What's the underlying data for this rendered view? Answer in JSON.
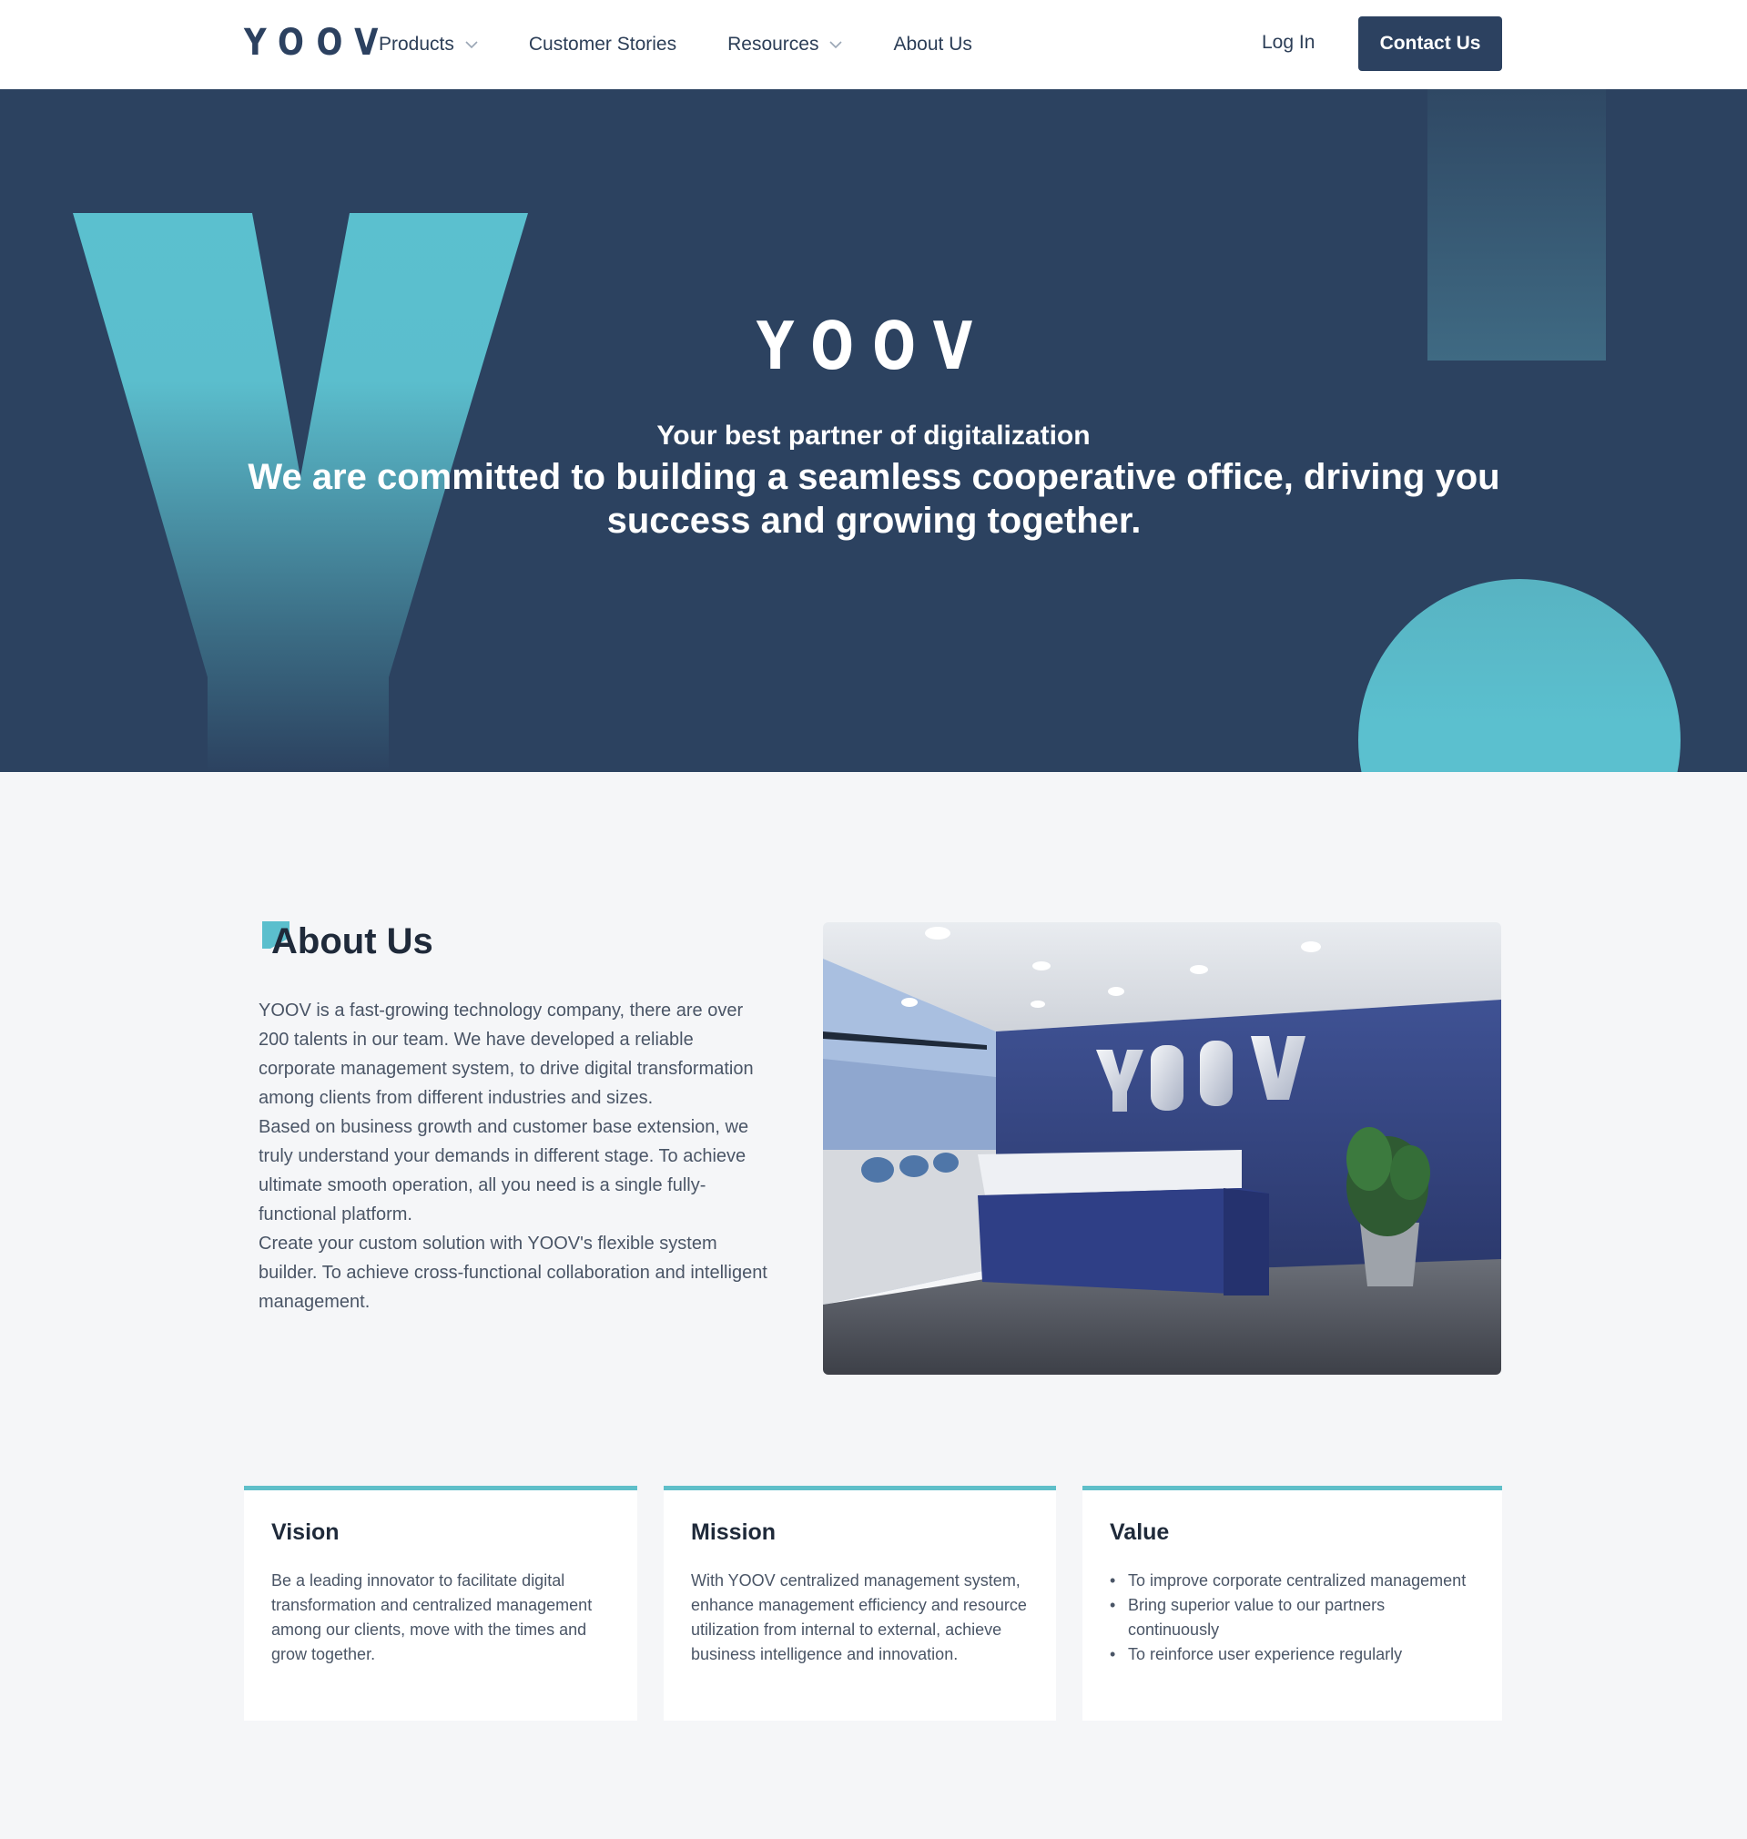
{
  "header": {
    "logo": "YOOV",
    "nav": [
      {
        "label": "Products",
        "has_dropdown": true
      },
      {
        "label": "Customer Stories",
        "has_dropdown": false
      },
      {
        "label": "Resources",
        "has_dropdown": true
      },
      {
        "label": "About Us",
        "has_dropdown": false
      }
    ],
    "login_label": "Log In",
    "contact_label": "Contact Us"
  },
  "hero": {
    "logo": "YOOV",
    "subtitle": "Your best partner of digitalization",
    "headline": "We are committed to building a seamless cooperative office, driving you success and growing together."
  },
  "about": {
    "title": "About Us",
    "paragraphs": [
      "YOOV is a fast-growing technology company, there are over 200 talents in our team. We have developed a reliable corporate management system, to drive digital transformation among clients from different industries and sizes.",
      "Based on business growth and customer base extension, we truly understand your demands in different stage. To achieve ultimate smooth operation, all you need is a single fully-functional platform.",
      "Create your custom solution with YOOV's flexible system builder. To achieve cross-functional collaboration and intelligent management."
    ],
    "photo_sign_text": "YOOV"
  },
  "cards": {
    "vision": {
      "title": "Vision",
      "body": "Be a leading innovator to facilitate digital transformation and centralized management among our clients, move with the times and grow together."
    },
    "mission": {
      "title": "Mission",
      "body": "With YOOV centralized management system, enhance management efficiency and resource utilization from internal to external, achieve business intelligence and innovation."
    },
    "value": {
      "title": "Value",
      "items": [
        "To improve corporate centralized management",
        "Bring superior value to our partners continuously",
        "To reinforce user experience regularly"
      ]
    }
  },
  "colors": {
    "navy": "#2c4260",
    "teal": "#5bbfcd",
    "page_bg": "#f5f6f8"
  },
  "icons": {
    "dropdown": "chevron-down-icon"
  }
}
